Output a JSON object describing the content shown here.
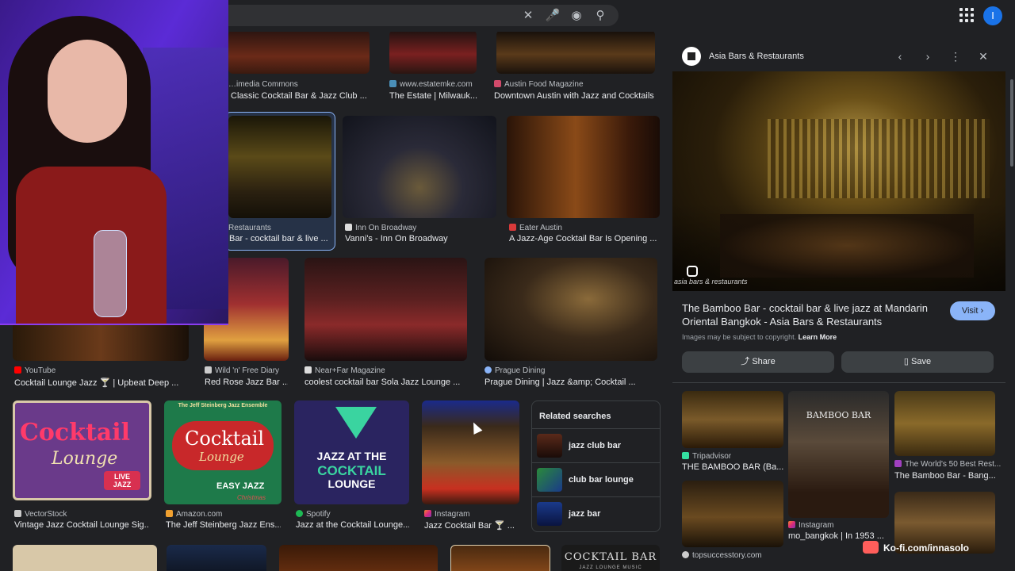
{
  "search": {
    "clear_icon": "close-icon",
    "mic_icon": "mic-icon",
    "lens_icon": "lens-icon",
    "search_icon": "search-icon"
  },
  "account": {
    "initial": "I"
  },
  "grid": {
    "row1": [
      {
        "source": "…imedia Commons",
        "title": "Classic Cocktail Bar & Jazz Club ..."
      },
      {
        "source": "www.estatemke.com",
        "title": "The Estate | Milwauk..."
      },
      {
        "source": "Austin Food Magazine",
        "title": "Downtown Austin with Jazz and Cocktails"
      }
    ],
    "row2": [
      {
        "source": "Restaurants",
        "title": "Bar - cocktail bar & live ..."
      },
      {
        "source": "Inn On Broadway",
        "title": "Vanni's - Inn On Broadway"
      },
      {
        "source": "Eater Austin",
        "title": "A Jazz-Age Cocktail Bar Is Opening ..."
      }
    ],
    "row3": [
      {
        "source": "YouTube",
        "title": "Cocktail Lounge Jazz 🍸 | Upbeat Deep ..."
      },
      {
        "source": "Wild 'n' Free Diary",
        "title": "Red Rose Jazz Bar ..."
      },
      {
        "source": "Near+Far Magazine",
        "title": "coolest cocktail bar Sola Jazz Lounge ..."
      },
      {
        "source": "Prague Dining",
        "title": "Prague Dining | Jazz &amp; Cocktail ..."
      }
    ],
    "row4": [
      {
        "source": "VectorStock",
        "title": "Vintage Jazz Cocktail Lounge Sig..."
      },
      {
        "source": "Amazon.com",
        "title": "The Jeff Steinberg Jazz Ens..."
      },
      {
        "source": "Spotify",
        "title": "Jazz at the Cocktail Lounge..."
      },
      {
        "source": "Instagram",
        "title": "Jazz Cocktail Bar 🍸 ..."
      }
    ],
    "art": {
      "cocktail_lounge_sign": [
        "Cocktail",
        "Lounge",
        "LIVE JAZZ"
      ],
      "steinberg_cover": [
        "The Jeff Steinberg Jazz Ensemble",
        "Cocktail",
        "Lounge",
        "EASY JAZZ",
        "Christmas"
      ],
      "spotify_cover": [
        "JAZZ AT THE",
        "COCKTAIL",
        "LOUNGE"
      ],
      "bottom_cover": [
        "COCKTAIL BAR",
        "JAZZ LOUNGE MUSIC"
      ]
    }
  },
  "related": {
    "heading": "Related searches",
    "items": [
      "jazz club bar",
      "club bar lounge",
      "jazz bar"
    ]
  },
  "panel": {
    "site": "Asia Bars & Restaurants",
    "watermark": "asia bars & restaurants",
    "title": "The Bamboo Bar - cocktail bar & live jazz at Mandarin Oriental Bangkok - Asia Bars & Restaurants",
    "visit": "Visit ›",
    "copyright": "Images may be subject to copyright.",
    "learn_more": "Learn More",
    "share": "Share",
    "save": "Save",
    "related": [
      {
        "source": "Tripadvisor",
        "title": "THE BAMBOO BAR (Ba..."
      },
      {
        "source": "The World's 50 Best Rest...",
        "title": "The Bamboo Bar - Bang..."
      },
      {
        "source": "Instagram",
        "title": "mo_bangkok | In 1953 ..."
      },
      {
        "source": "topsuccesstory.com",
        "title": ""
      }
    ],
    "bamboo_logo": "BAMBOO BAR"
  },
  "overlay": {
    "kofi": "Ko-fi.com/innasolo"
  },
  "colors": {
    "bg": "#202124",
    "accent": "#8ab4f8",
    "kofi": "#ff5e5b"
  }
}
